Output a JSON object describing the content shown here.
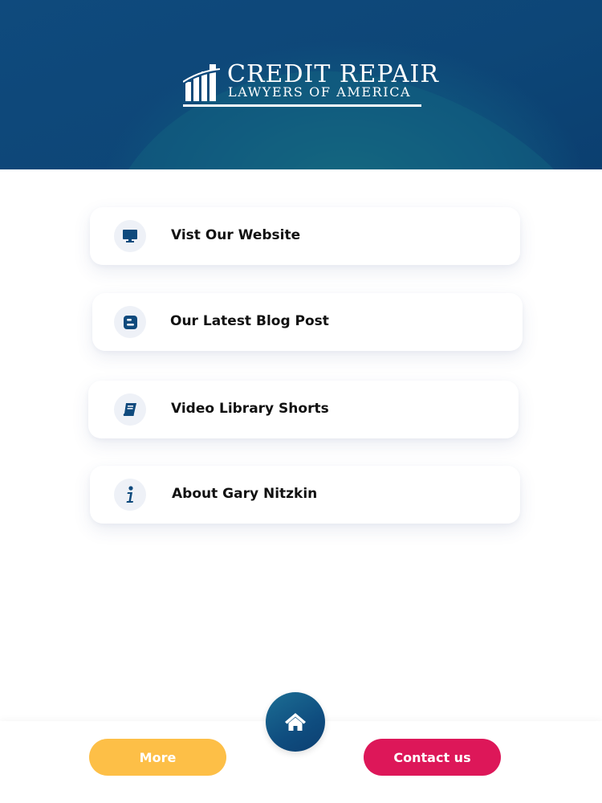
{
  "brand": {
    "line1": "CREDIT REPAIR",
    "line2": "LAWYERS OF AMERICA"
  },
  "menu": [
    {
      "label": "Vist Our Website",
      "icon": "monitor-icon"
    },
    {
      "label": "Our Latest Blog Post",
      "icon": "blogger-icon"
    },
    {
      "label": "Video Library Shorts",
      "icon": "book-icon"
    },
    {
      "label": "About Gary Nitzkin",
      "icon": "info-icon"
    }
  ],
  "footer": {
    "more_label": "More",
    "contact_label": "Contact us",
    "home_icon": "home-icon"
  },
  "colors": {
    "primary": "#0f4a7d",
    "more": "#fdbf47",
    "contact": "#dd1759",
    "icon_bg": "#eef1f7"
  }
}
